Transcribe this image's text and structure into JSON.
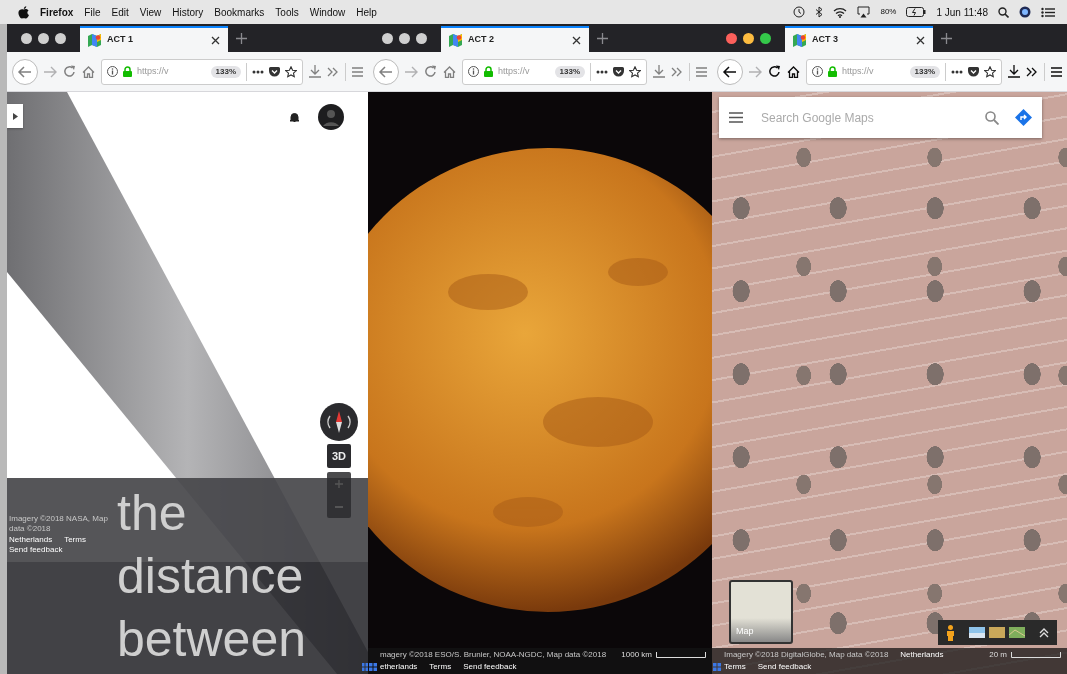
{
  "menu_bar": {
    "app_name": "Firefox",
    "menus": [
      "File",
      "Edit",
      "View",
      "History",
      "Bookmarks",
      "Tools",
      "Window",
      "Help"
    ],
    "battery": "80%",
    "clock": "1 Jun 11:48"
  },
  "windows": [
    {
      "kind": "space",
      "active": false,
      "tab_title": "ACT 1",
      "url": "https://v",
      "zoom": "133%",
      "forward_disabled": true,
      "overlay_lines": [
        "the",
        "distance",
        "between"
      ],
      "view_button": "3D",
      "footer_lines": [
        [
          {
            "text": "Imagery ©2018 NASA, Map data ©2018",
            "kind": "credit"
          }
        ],
        [
          {
            "text": "Netherlands",
            "kind": "link"
          },
          {
            "text": "Terms",
            "kind": "link"
          }
        ],
        [
          {
            "text": "Send feedback",
            "kind": "link"
          }
        ]
      ]
    },
    {
      "kind": "planet",
      "active": false,
      "tab_title": "ACT 2",
      "url": "https://v",
      "zoom": "133%",
      "forward_disabled": true,
      "scale": "1000 km",
      "footer_lines": [
        [
          {
            "text": "magery ©2018 ESO/S. Brunier, NOAA-NGDC, Map data ©2018",
            "kind": "credit"
          }
        ],
        [
          {
            "text": "etherlands",
            "kind": "link"
          },
          {
            "text": "Terms",
            "kind": "link"
          },
          {
            "text": "Send feedback",
            "kind": "link"
          }
        ]
      ]
    },
    {
      "kind": "satellite",
      "active": true,
      "tab_title": "ACT 3",
      "url": "https://v",
      "zoom": "133%",
      "forward_disabled": true,
      "search_placeholder": "Search Google Maps",
      "thumbnail_label": "Map",
      "scale": "20 m",
      "footer_lines": [
        [
          {
            "text": "Imagery ©2018 DigitalGlobe, Map data ©2018",
            "kind": "credit"
          },
          {
            "text": "Netherlands",
            "kind": "link"
          }
        ],
        [
          {
            "text": "Terms",
            "kind": "link"
          },
          {
            "text": "Send feedback",
            "kind": "link"
          }
        ]
      ]
    }
  ]
}
